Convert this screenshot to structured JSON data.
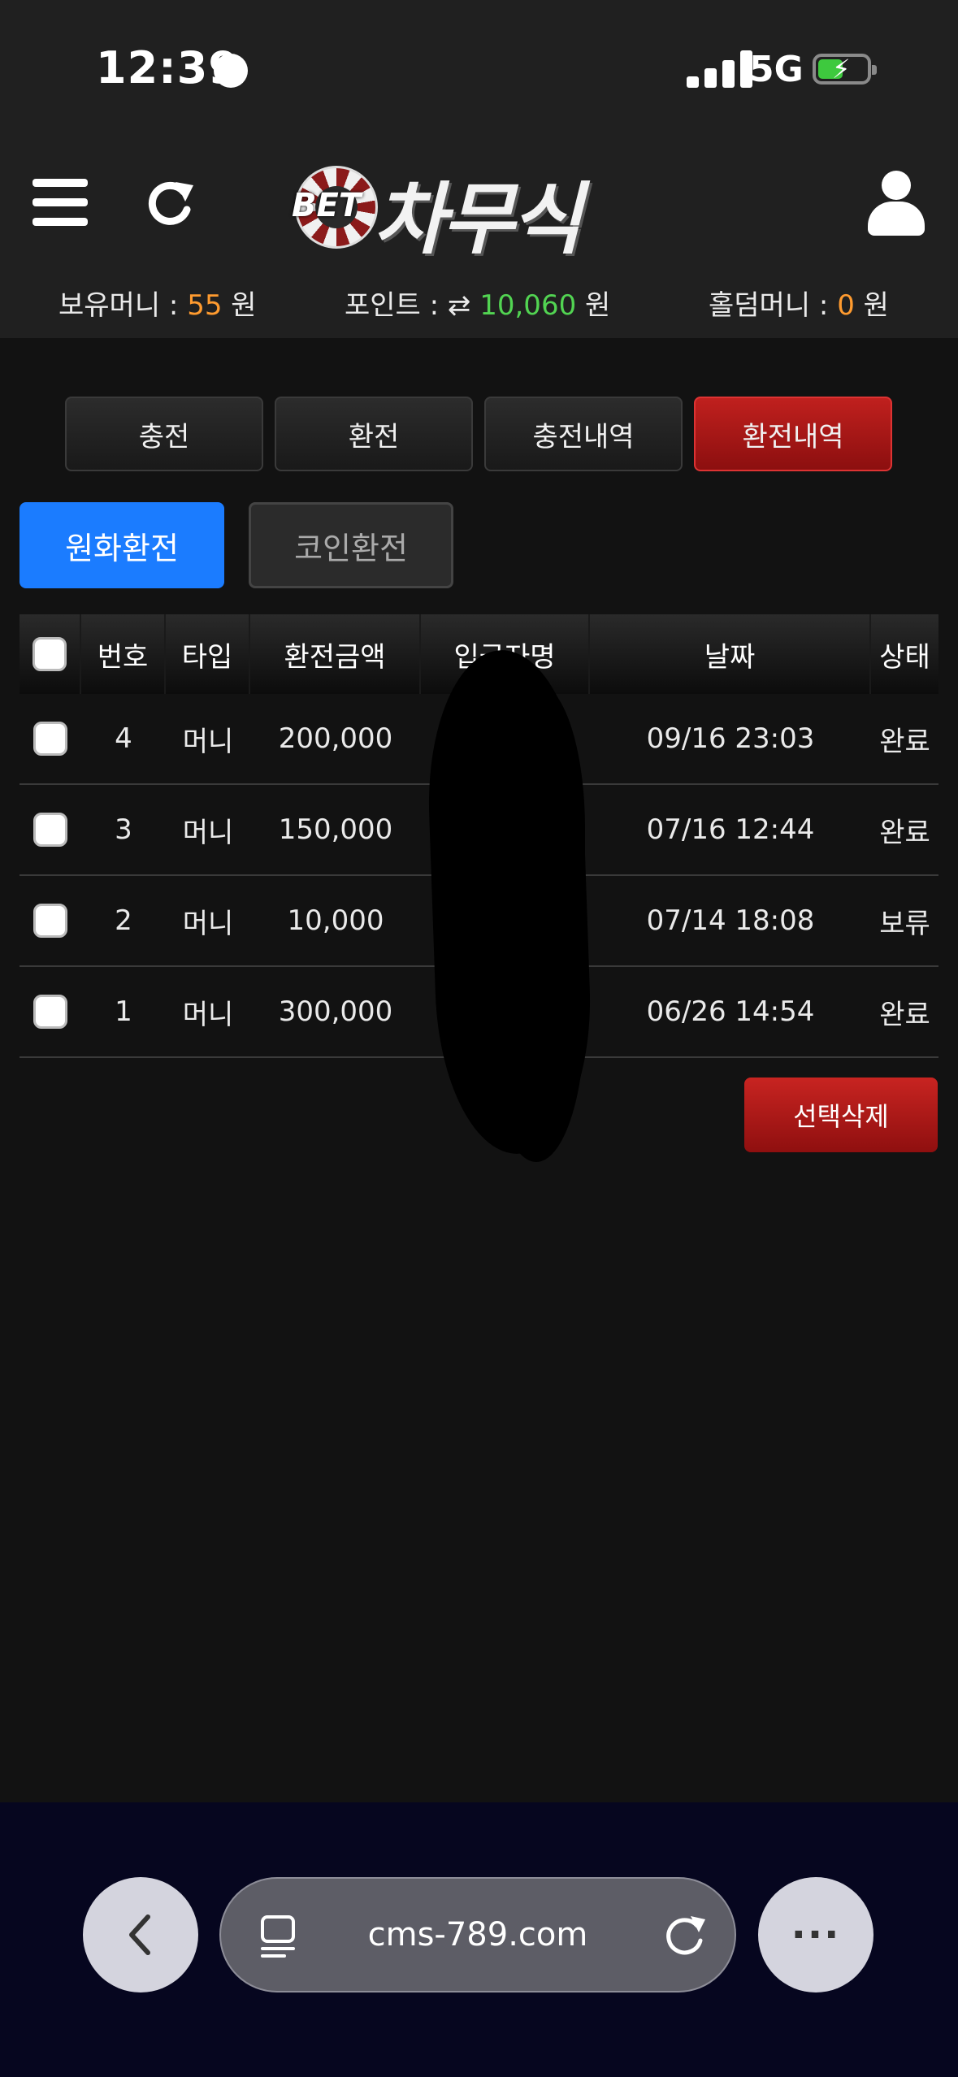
{
  "status_bar": {
    "time": "12:39",
    "network": "5G"
  },
  "header": {
    "logo_prefix": "BET",
    "logo_name": "차무식",
    "balances": {
      "money_label": "보유머니 :",
      "money_value": "55",
      "money_unit": "원",
      "point_label": "포인트 :",
      "point_icon": "⇄",
      "point_value": "10,060",
      "point_unit": "원",
      "holdem_label": "홀덤머니 :",
      "holdem_value": "0",
      "holdem_unit": "원"
    }
  },
  "tabs": [
    "충전",
    "환전",
    "충전내역",
    "환전내역"
  ],
  "sub_tabs": [
    "원화환전",
    "코인환전"
  ],
  "table": {
    "headers": [
      "번호",
      "타입",
      "환전금액",
      "입금자명",
      "날짜",
      "상태"
    ],
    "rows": [
      {
        "no": "4",
        "type": "머니",
        "amount": "200,000",
        "depositor": "",
        "date": "09/16 23:03",
        "status": "완료"
      },
      {
        "no": "3",
        "type": "머니",
        "amount": "150,000",
        "depositor": "",
        "date": "07/16 12:44",
        "status": "완료"
      },
      {
        "no": "2",
        "type": "머니",
        "amount": "10,000",
        "depositor": "",
        "date": "07/14 18:08",
        "status": "보류"
      },
      {
        "no": "1",
        "type": "머니",
        "amount": "300,000",
        "depositor": "",
        "date": "06/26 14:54",
        "status": "완료"
      }
    ]
  },
  "delete_button": "선택삭제",
  "browser": {
    "url": "cms-789.com",
    "more": "···",
    "back": "‹"
  },
  "colors": {
    "accent_red": "#a8161a",
    "accent_blue": "#1b7cff",
    "money_orange": "#ff9b2f",
    "point_green": "#52d452"
  }
}
